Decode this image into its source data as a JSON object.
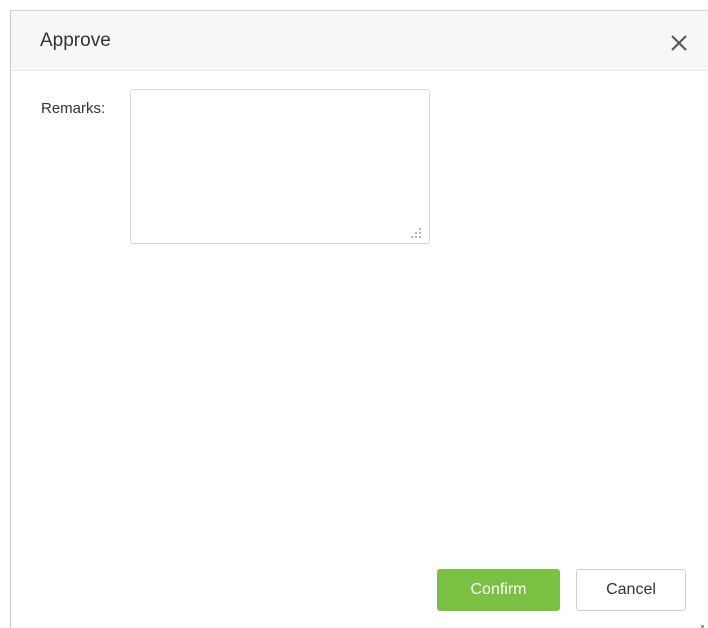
{
  "dialog": {
    "title": "Approve",
    "close_icon": "close-icon"
  },
  "form": {
    "remarks_label": "Remarks:",
    "remarks_value": ""
  },
  "footer": {
    "confirm_label": "Confirm",
    "cancel_label": "Cancel"
  },
  "colors": {
    "accent": "#7ac143",
    "header_bg": "#f7f7f7",
    "text": "#333333"
  }
}
